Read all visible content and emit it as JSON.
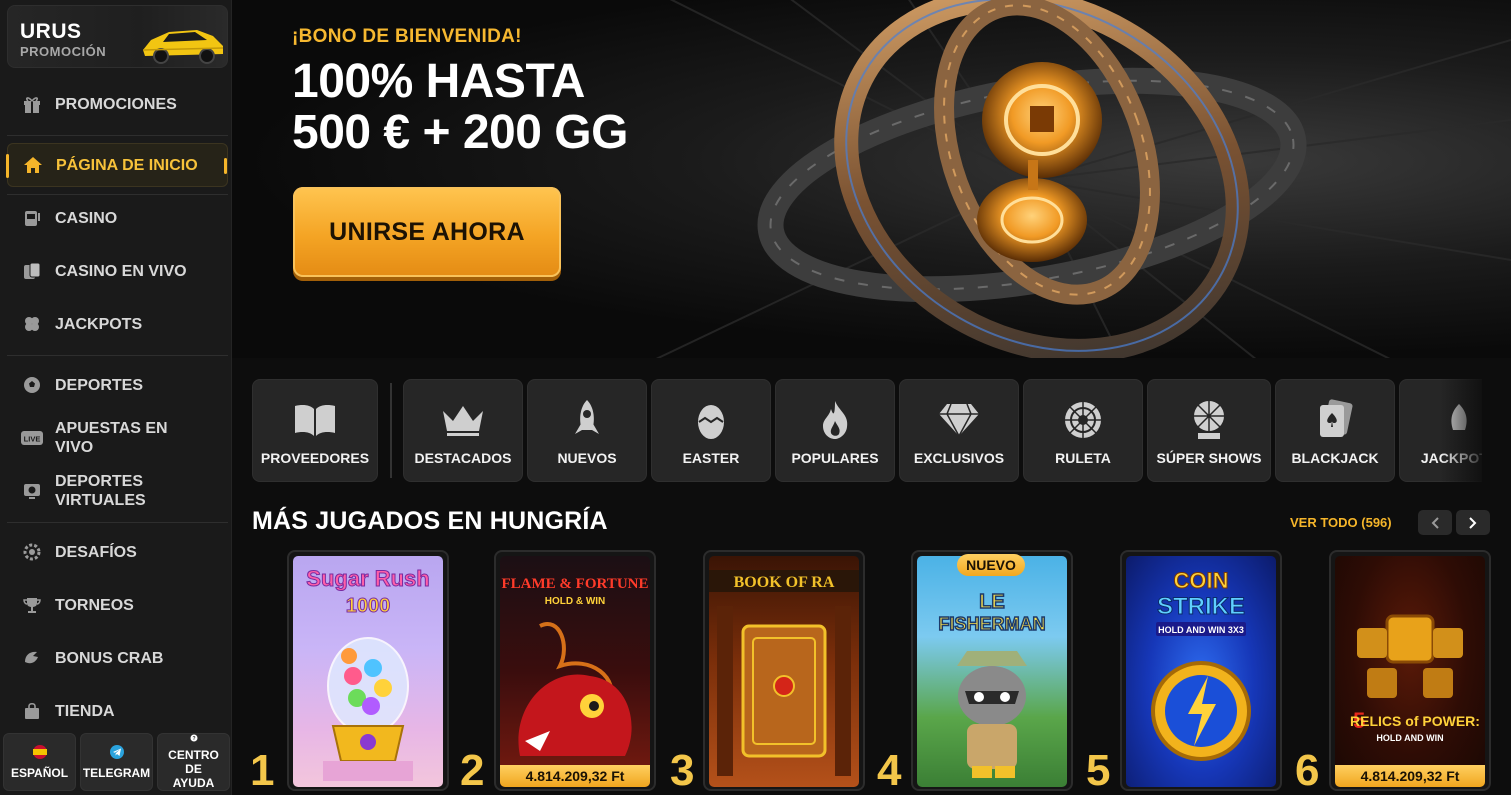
{
  "sidebar": {
    "promo": {
      "title": "URUS",
      "subtitle": "PROMOCIÓN",
      "icon": "car-icon"
    },
    "items": [
      {
        "label": "PROMOCIONES",
        "icon": "gift-icon"
      },
      {
        "label": "PÁGINA DE INICIO",
        "icon": "home-icon",
        "active": true
      },
      {
        "label": "CASINO",
        "icon": "slot-machine-icon"
      },
      {
        "label": "CASINO EN VIVO",
        "icon": "live-cards-icon"
      },
      {
        "label": "JACKPOTS",
        "icon": "clover-icon"
      },
      {
        "label": "DEPORTES",
        "icon": "soccer-ball-icon"
      },
      {
        "label": "APUESTAS EN VIVO",
        "icon": "live-badge-icon"
      },
      {
        "label": "DEPORTES VIRTUALES",
        "icon": "virtual-sports-icon"
      },
      {
        "label": "DESAFÍOS",
        "icon": "challenge-icon"
      },
      {
        "label": "TORNEOS",
        "icon": "trophy-icon"
      },
      {
        "label": "BONUS CRAB",
        "icon": "crab-claw-icon"
      },
      {
        "label": "TIENDA",
        "icon": "shopping-bag-icon"
      }
    ],
    "bottom": [
      {
        "label": "ESPAÑOL",
        "icon": "spain-flag-icon"
      },
      {
        "label": "TELEGRAM",
        "icon": "telegram-icon"
      },
      {
        "label": "CENTRO DE AYUDA",
        "icon": "help-icon"
      }
    ]
  },
  "hero": {
    "tag": "¡BONO DE BIENVENIDA!",
    "title_line1": "100% HASTA",
    "title_line2": "500 € + 200 GG",
    "cta": "UNIRSE AHORA"
  },
  "categories": [
    {
      "label": "PROVEEDORES",
      "icon": "book-icon"
    },
    {
      "label": "DESTACADOS",
      "icon": "crown-icon"
    },
    {
      "label": "NUEVOS",
      "icon": "rocket-icon"
    },
    {
      "label": "EASTER",
      "icon": "easter-egg-icon"
    },
    {
      "label": "POPULARES",
      "icon": "flame-icon"
    },
    {
      "label": "EXCLUSIVOS",
      "icon": "diamond-icon"
    },
    {
      "label": "RULETA",
      "icon": "roulette-icon"
    },
    {
      "label": "SÚPER SHOWS",
      "icon": "wheel-show-icon"
    },
    {
      "label": "BLACKJACK",
      "icon": "cards-spade-icon"
    },
    {
      "label": "JACKPOTS",
      "icon": "jackpot-icon"
    }
  ],
  "section": {
    "title": "MÁS JUGADOS EN HUNGRÍA",
    "view_all": "VER TODO (596)"
  },
  "games": [
    {
      "rank": "1",
      "name": "Sugar Rush 1000",
      "jackpot": "",
      "badge": ""
    },
    {
      "rank": "2",
      "name": "Flame & Fortune Hold & Win",
      "jackpot": "4.814.209,32 Ft",
      "badge": ""
    },
    {
      "rank": "3",
      "name": "Book of Ra",
      "jackpot": "",
      "badge": ""
    },
    {
      "rank": "4",
      "name": "Le Fisherman",
      "jackpot": "",
      "badge": "NUEVO"
    },
    {
      "rank": "5",
      "name": "Coin Strike Hold and Win 3x3",
      "jackpot": "",
      "badge": ""
    },
    {
      "rank": "6",
      "name": "5 Relics of Power: Hold and Win",
      "jackpot": "4.814.209,32 Ft",
      "badge": ""
    }
  ],
  "colors": {
    "accent": "#f5b52a",
    "background": "#0d0d0d",
    "sidebar": "#1a1a1a",
    "card": "#262626"
  }
}
